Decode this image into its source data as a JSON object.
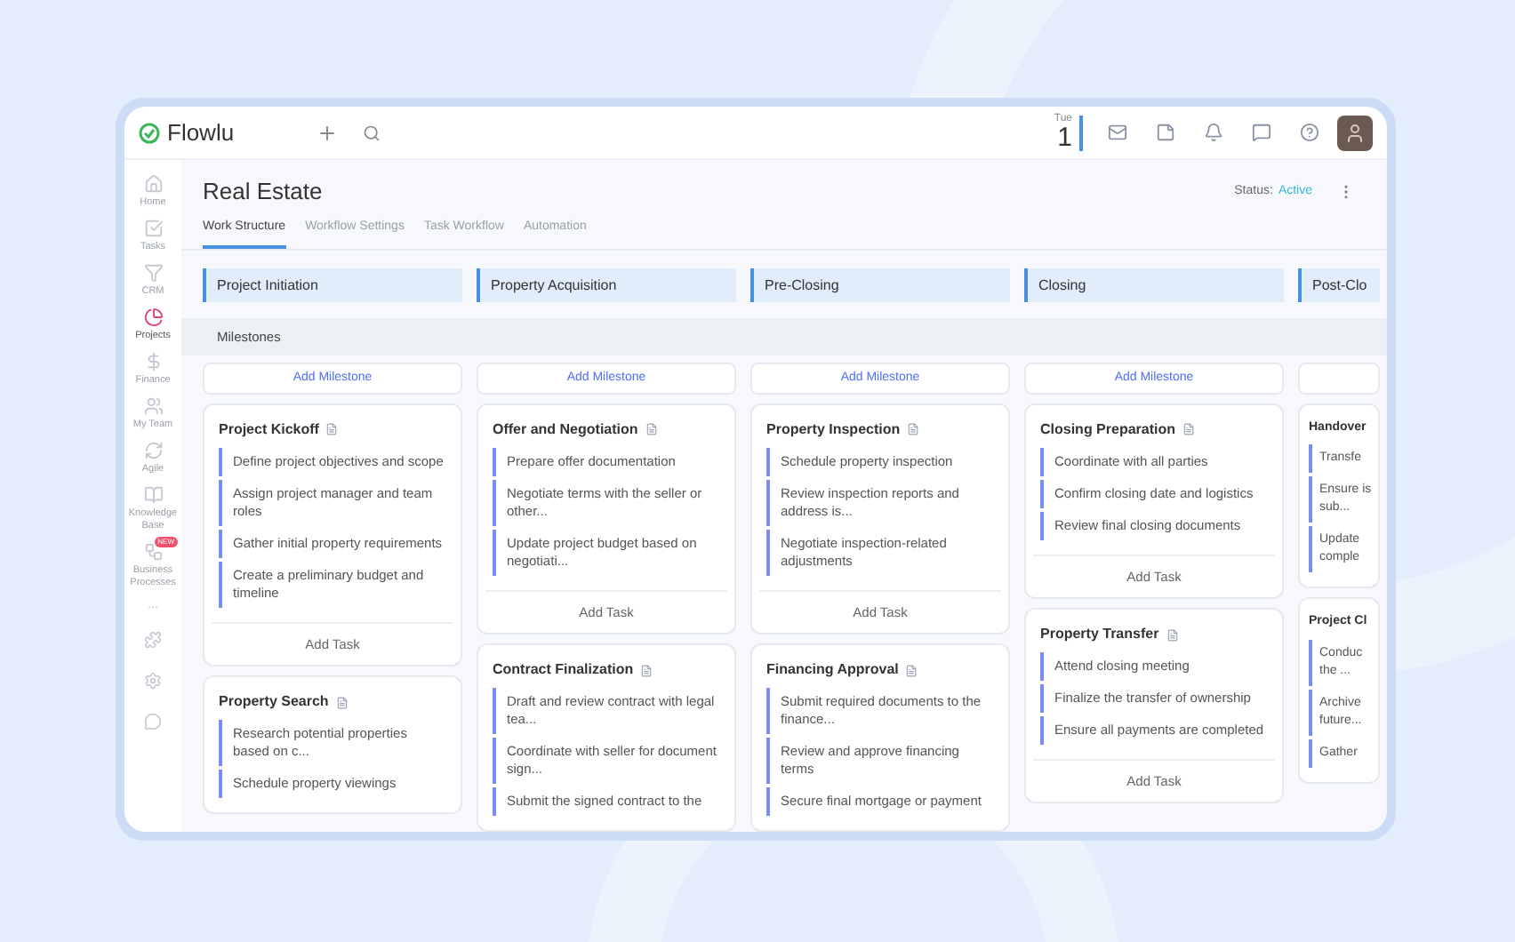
{
  "app": {
    "logo": "Flowlu"
  },
  "top_bar": {
    "day": "Tue",
    "date": "1"
  },
  "sidebar": {
    "items": [
      {
        "label": "Home",
        "selected": false
      },
      {
        "label": "Tasks",
        "selected": false
      },
      {
        "label": "CRM",
        "selected": false
      },
      {
        "label": "Projects",
        "selected": true
      },
      {
        "label": "Finance",
        "selected": false
      },
      {
        "label": "My Team",
        "selected": false
      },
      {
        "label": "Agile",
        "selected": false
      },
      {
        "label": "Knowledge Base",
        "selected": false
      },
      {
        "label": "Business Processes",
        "selected": false,
        "badge": "NEW"
      }
    ],
    "more": "..."
  },
  "project": {
    "title": "Real Estate",
    "status_label": "Status:",
    "status": "Active"
  },
  "tabs": [
    {
      "label": "Work Structure",
      "selected": true
    },
    {
      "label": "Workflow Settings",
      "selected": false
    },
    {
      "label": "Task Workflow",
      "selected": false
    },
    {
      "label": "Automation",
      "selected": false
    }
  ],
  "milestones_label": "Milestones",
  "columns": [
    {
      "title": "Project Initiation",
      "add_milestone": "Add Milestone",
      "milestones": [
        {
          "title": "Project Kickoff",
          "tasks": [
            "Define project objectives and scope",
            "Assign project manager and team roles",
            "Gather initial property requirements",
            "Create a preliminary budget and timeline"
          ],
          "add_task": "Add Task"
        },
        {
          "title": "Property Search",
          "tasks": [
            "Research potential properties based on c...",
            "Schedule property viewings"
          ]
        }
      ]
    },
    {
      "title": "Property Acquisition",
      "add_milestone": "Add Milestone",
      "milestones": [
        {
          "title": "Offer and Negotiation",
          "tasks": [
            "Prepare offer documentation",
            "Negotiate terms with the seller or other...",
            "Update project budget based on negotiati..."
          ],
          "add_task": "Add Task"
        },
        {
          "title": "Contract Finalization",
          "tasks": [
            "Draft and review contract with legal tea...",
            "Coordinate with seller for document sign...",
            "Submit the signed contract to the"
          ]
        }
      ]
    },
    {
      "title": "Pre-Closing",
      "add_milestone": "Add Milestone",
      "milestones": [
        {
          "title": "Property Inspection",
          "tasks": [
            "Schedule property inspection",
            "Review inspection reports and address is...",
            "Negotiate inspection-related adjustments"
          ],
          "add_task": "Add Task"
        },
        {
          "title": "Financing Approval",
          "tasks": [
            "Submit required documents to the finance...",
            "Review and approve financing terms",
            "Secure final mortgage or payment"
          ]
        }
      ]
    },
    {
      "title": "Closing",
      "add_milestone": "Add Milestone",
      "milestones": [
        {
          "title": "Closing Preparation",
          "tasks": [
            "Coordinate with all parties",
            "Confirm closing date and logistics",
            "Review final closing documents"
          ],
          "add_task": "Add Task"
        },
        {
          "title": "Property Transfer",
          "tasks": [
            "Attend closing meeting",
            "Finalize the transfer of ownership",
            "Ensure all payments are completed"
          ],
          "add_task": "Add Task"
        }
      ]
    },
    {
      "title": "Post-Clo",
      "milestones": [
        {
          "title": "Handover",
          "tasks": [
            "Transfe",
            "Ensure is sub...",
            "Update comple"
          ]
        },
        {
          "title": "Project Cl",
          "tasks": [
            "Conduc the ...",
            "Archive future...",
            "Gather"
          ]
        }
      ]
    }
  ]
}
